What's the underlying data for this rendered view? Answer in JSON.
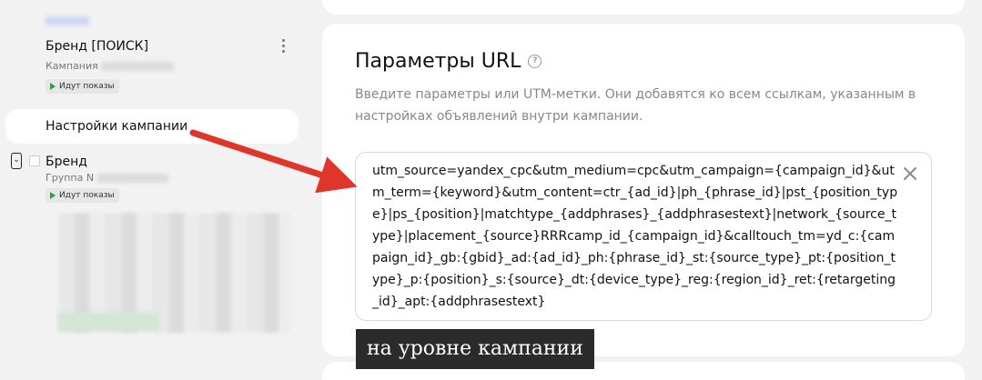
{
  "sidebar": {
    "campaign": {
      "title": "Бренд [ПОИСК]",
      "subtitle": "Кампания",
      "status": "Идут показы"
    },
    "settings_item": "Настройки кампании",
    "group": {
      "title": "Бренд",
      "subtitle": "Группа N",
      "status": "Идут показы"
    }
  },
  "url_params": {
    "title": "Параметры URL",
    "description": "Введите параметры или UTM-метки. Они добавятся ко всем ссылкам, указанным в настройках объявлений внутри кампании.",
    "value": "utm_source=yandex_cpc&utm_medium=cpc&utm_campaign={campaign_id}&utm_term={keyword}&utm_content=ctr_{ad_id}|ph_{phrase_id}|pst_{position_type}|ps_{position}|matchtype_{addphrases}_{addphrasestext}|network_{source_type}|placement_{source}RRRcamp_id_{campaign_id}&calltouch_tm=yd_c:{campaign_id}_gb:{gbid}_ad:{ad_id}_ph:{phrase_id}_st:{source_type}_pt:{position_type}_p:{position}_s:{source}_dt:{device_type}_reg:{region_id}_ret:{retargeting_id}_apt:{addphrasestext}"
  },
  "annotation": {
    "caption": "на уровне кампании",
    "arrow_color": "#e0352b"
  },
  "colors": {
    "background": "#f2f2f2",
    "panel": "#ffffff",
    "status_green": "#22a53a"
  }
}
